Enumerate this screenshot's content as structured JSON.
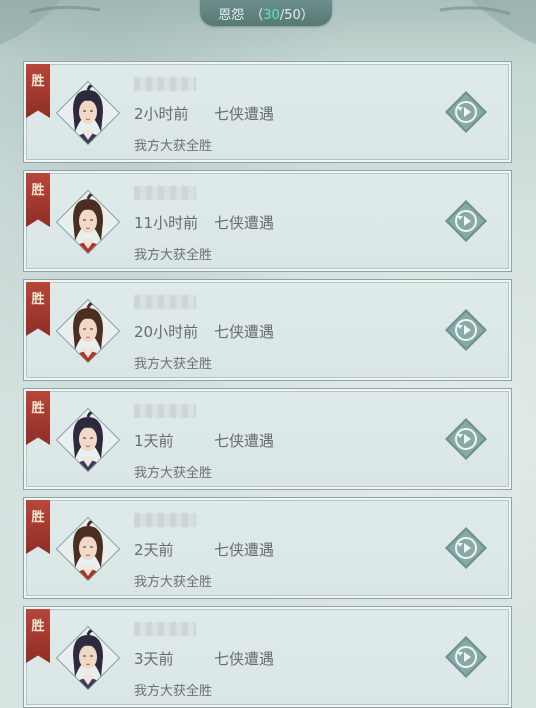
{
  "header": {
    "title": "恩怨",
    "current": "30",
    "total": "50",
    "open_paren": "（",
    "slash": "/",
    "close_paren": "）"
  },
  "records": [
    {
      "badge": "胜",
      "time": "2小时前",
      "mode": "七侠遭遇",
      "result": "我方大获全胜",
      "avatar": "purple-hair"
    },
    {
      "badge": "胜",
      "time": "11小时前",
      "mode": "七侠遭遇",
      "result": "我方大获全胜",
      "avatar": "brown-hair"
    },
    {
      "badge": "胜",
      "time": "20小时前",
      "mode": "七侠遭遇",
      "result": "我方大获全胜",
      "avatar": "brown-hair"
    },
    {
      "badge": "胜",
      "time": "1天前",
      "mode": "七侠遭遇",
      "result": "我方大获全胜",
      "avatar": "purple-hair"
    },
    {
      "badge": "胜",
      "time": "2天前",
      "mode": "七侠遭遇",
      "result": "我方大获全胜",
      "avatar": "brown-hair"
    },
    {
      "badge": "胜",
      "time": "3天前",
      "mode": "七侠遭遇",
      "result": "我方大获全胜",
      "avatar": "purple-hair"
    }
  ],
  "colors": {
    "win_flag": "#a33b30",
    "count_highlight": "#5fe6b8",
    "replay_icon": "#5c7f7b"
  },
  "icons": {
    "replay": "replay-icon",
    "avatar": "character-portrait-icon"
  }
}
